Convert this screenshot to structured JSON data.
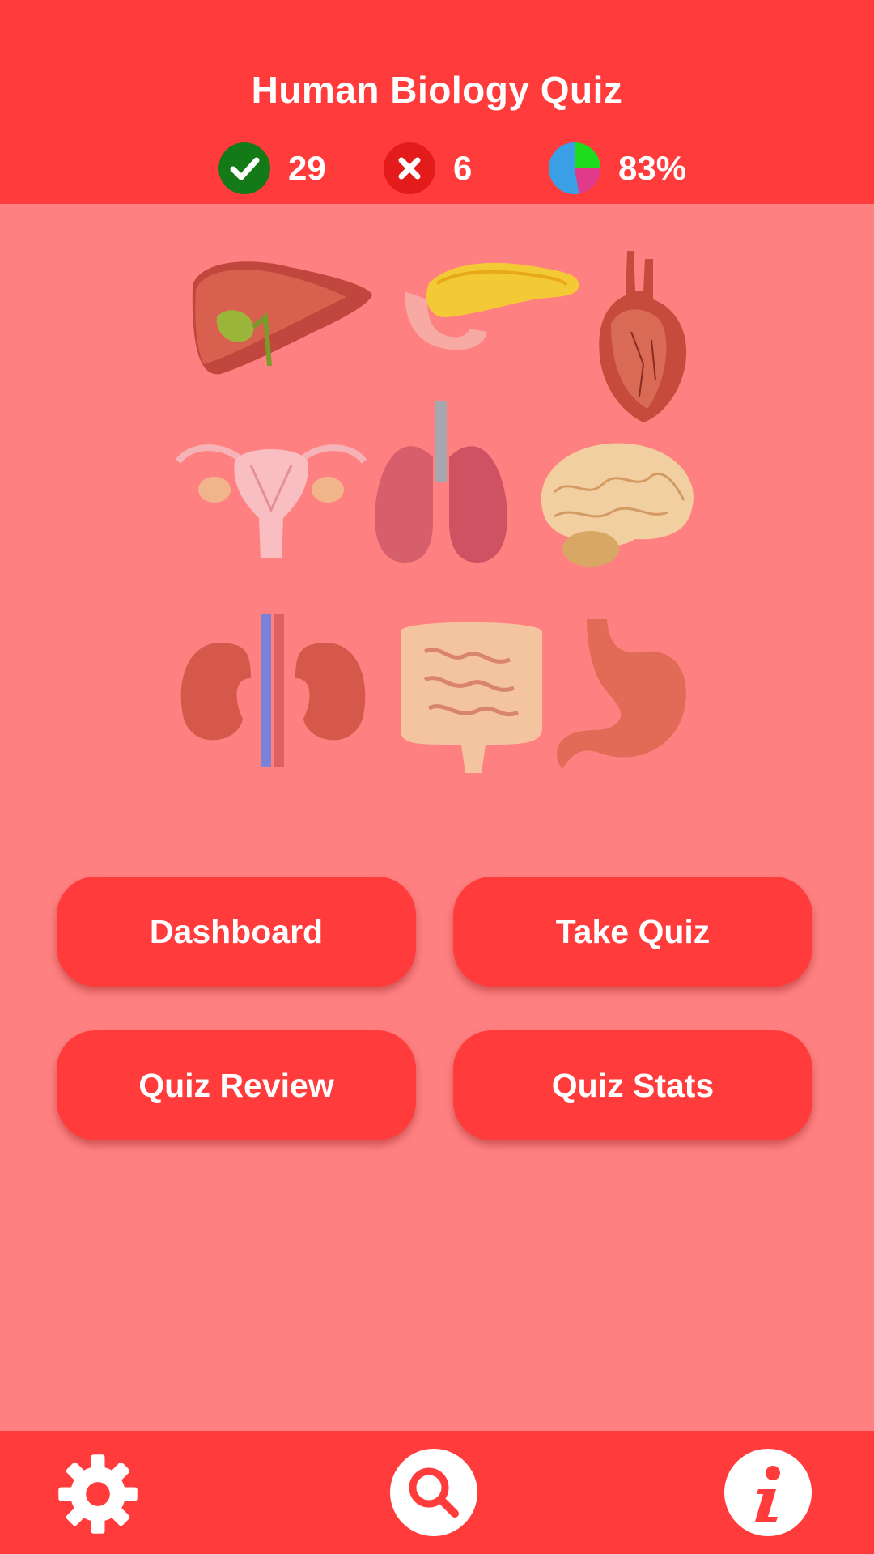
{
  "app": {
    "title": "Human Biology Quiz"
  },
  "stats": {
    "correct": "29",
    "wrong": "6",
    "percent": "83%"
  },
  "organs": [
    "liver",
    "pancreas",
    "heart",
    "uterus",
    "lungs",
    "brain",
    "kidneys",
    "intestines",
    "stomach"
  ],
  "buttons": {
    "dashboard": "Dashboard",
    "take_quiz": "Take Quiz",
    "quiz_review": "Quiz Review",
    "quiz_stats": "Quiz Stats"
  },
  "footer": {
    "settings_icon": "gear-icon",
    "search_icon": "search-icon",
    "info_icon": "info-icon"
  },
  "colors": {
    "primary": "#FF3B3B",
    "background": "#FF8080",
    "correct": "#1E8C1E",
    "wrong": "#E31B1B"
  }
}
